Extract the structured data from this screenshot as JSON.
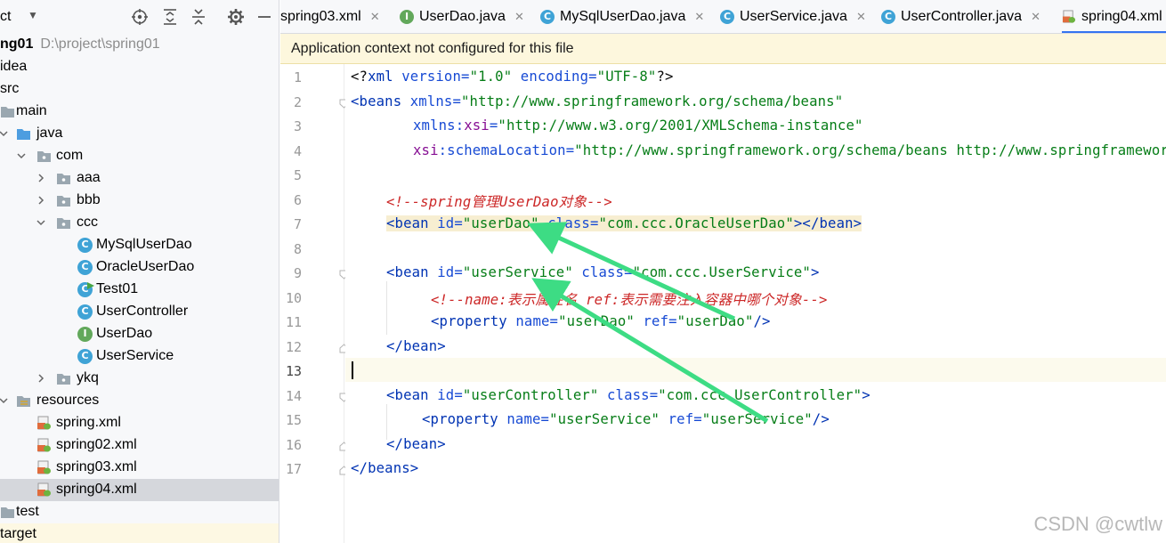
{
  "project_panel": {
    "title": "ct",
    "tree": [
      {
        "label": "ng01",
        "path": "D:\\project\\spring01"
      },
      {
        "label": "idea"
      },
      {
        "label": "src"
      },
      {
        "label": "main"
      },
      {
        "label": "java"
      },
      {
        "label": "com"
      },
      {
        "label": "aaa"
      },
      {
        "label": "bbb"
      },
      {
        "label": "ccc"
      },
      {
        "label": "MySqlUserDao"
      },
      {
        "label": "OracleUserDao"
      },
      {
        "label": "Test01"
      },
      {
        "label": "UserController"
      },
      {
        "label": "UserDao"
      },
      {
        "label": "UserService"
      },
      {
        "label": "ykq"
      },
      {
        "label": "resources"
      },
      {
        "label": "spring.xml"
      },
      {
        "label": "spring02.xml"
      },
      {
        "label": "spring03.xml"
      },
      {
        "label": "spring04.xml"
      },
      {
        "label": "test"
      },
      {
        "label": "target"
      }
    ]
  },
  "tabs": [
    {
      "label": "spring03.xml"
    },
    {
      "label": "UserDao.java"
    },
    {
      "label": "MySqlUserDao.java"
    },
    {
      "label": "UserService.java"
    },
    {
      "label": "UserController.java"
    },
    {
      "label": "spring04.xml"
    }
  ],
  "banner": "Application context not configured for this file",
  "editor": {
    "line_numbers": [
      "1",
      "2",
      "3",
      "4",
      "5",
      "6",
      "7",
      "8",
      "9",
      "10",
      "11",
      "12",
      "13",
      "14",
      "15",
      "16",
      "17"
    ],
    "code": {
      "l1": {
        "a": "<?",
        "b": "xml",
        "c": " version=",
        "d": "\"1.0\"",
        "e": " encoding=",
        "f": "\"UTF-8\"",
        "g": "?>"
      },
      "l2": {
        "a": "<beans",
        "b": " xmlns=",
        "c": "\"http://www.springframework.org/schema/beans\""
      },
      "l3": {
        "a": "xmlns:",
        "b": "xsi",
        "c": "=",
        "d": "\"http://www.w3.org/2001/XMLSchema-instance\""
      },
      "l4": {
        "a": "xsi",
        "b": ":schemaLocation=",
        "c": "\"http://www.springframework.org/schema/beans http://www.springframework\""
      },
      "l6": "<!--spring管理UserDao对象-->",
      "l7": {
        "a": "<bean",
        "b": " id=",
        "c": "\"userDao\"",
        "d": " class=",
        "e": "\"com.ccc.OracleUserDao\"",
        "f": "></bean>"
      },
      "l9": {
        "a": "<bean",
        "b": " id=",
        "c": "\"userService\"",
        "d": " class=",
        "e": "\"com.ccc.UserService\"",
        "f": ">"
      },
      "l10": "<!--name:表示属性名 ref:表示需要注入容器中哪个对象-->",
      "l11": {
        "a": "<property",
        "b": " name=",
        "c": "\"userDao\"",
        "d": " ref=",
        "e": "\"userDao\"",
        "f": "/>"
      },
      "l12": "</bean>",
      "l14": {
        "a": "<bean",
        "b": " id=",
        "c": "\"userController\"",
        "d": " class=",
        "e": "\"com.ccc.UserController\"",
        "f": ">"
      },
      "l15": {
        "a": "<property",
        "b": " name=",
        "c": "\"userService\"",
        "d": " ref=",
        "e": "\"userService\"",
        "f": "/>"
      },
      "l16": "</bean>",
      "l17": "</beans>"
    }
  },
  "watermark": "CSDN @cwtlw",
  "colors": {
    "accent": "#3574f0",
    "annotation_arrow": "#3ddc84",
    "banner_bg": "#fdf7dd"
  }
}
